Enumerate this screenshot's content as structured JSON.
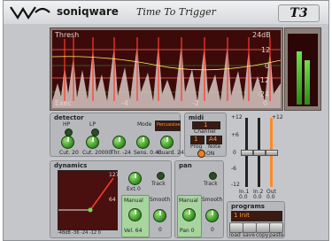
{
  "header": {
    "brand": "soniqware",
    "title": "Time To Trigger",
    "badge": "T3"
  },
  "display": {
    "top_left": "Thresh",
    "right_scale": [
      "24dB",
      "12",
      "0",
      "-12",
      "-24"
    ],
    "bottom_left": "Exec",
    "bottom_marks": [
      "-4",
      "-2",
      "0"
    ]
  },
  "detector": {
    "title": "detector",
    "hp_label": "HP",
    "lp_label": "LP",
    "mode_label": "Mode",
    "mode_value": "Percussive",
    "knobs": [
      "Cut. 20",
      "Cut. 20000",
      "Thr. -24",
      "Sens. 0.40",
      "Guard. 24"
    ]
  },
  "midi": {
    "title": "midi",
    "channel_label": "Channel",
    "channel_value": "1",
    "prog_label": "Prog",
    "prog_value": "1",
    "note_label": "Note",
    "note_value": "A4",
    "on_label": "ON"
  },
  "faders": {
    "scale": [
      "+12",
      "+6",
      "0",
      "-6",
      "-12"
    ],
    "labels": [
      "In.1",
      "In.2",
      "Out"
    ],
    "values": [
      "0.0",
      "0.0",
      "0.0"
    ]
  },
  "dynamics": {
    "title": "dynamics",
    "graph_top": "127",
    "graph_mid": "64",
    "axis_label": "-48dB -36 -24 -12 0",
    "ext_label": "Ext.",
    "ext_value": "0",
    "track_label": "Track",
    "manual_label": "Manual",
    "vel_label": "Vel. 64",
    "smooth_label": "Smooth",
    "smooth_value": "0"
  },
  "pan": {
    "title": "pan",
    "track_label": "Track",
    "manual_label": "Manual",
    "pan_label": "Pan 0",
    "smooth_label": "Smooth",
    "smooth_value": "0"
  },
  "programs": {
    "title": "programs",
    "selected": "1 Init",
    "buttons": [
      "load",
      "save",
      "copy",
      "paste"
    ]
  }
}
